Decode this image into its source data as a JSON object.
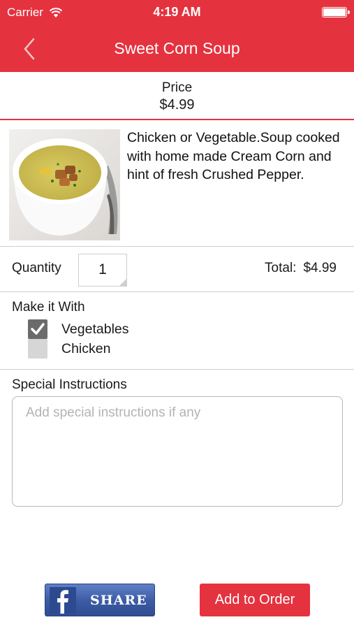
{
  "status_bar": {
    "carrier": "Carrier",
    "time": "4:19 AM"
  },
  "nav": {
    "title": "Sweet Corn Soup",
    "back_icon": "chevron-left-icon"
  },
  "price": {
    "label": "Price",
    "value": "$4.99"
  },
  "product": {
    "description": "Chicken or Vegetable.Soup cooked with home made Cream Corn and hint of fresh Crushed Pepper."
  },
  "quantity": {
    "label": "Quantity",
    "value": "1",
    "total_label": "Total:",
    "total_value": "$4.99"
  },
  "options": {
    "title": "Make it With",
    "items": [
      {
        "label": "Vegetables",
        "checked": true
      },
      {
        "label": "Chicken",
        "checked": false
      }
    ]
  },
  "instructions": {
    "title": "Special Instructions",
    "placeholder": "Add special instructions if any"
  },
  "buttons": {
    "share_label": "SHARE",
    "add_to_order": "Add to Order"
  },
  "colors": {
    "accent": "#e5323f",
    "facebook": "#3b5aa3"
  }
}
